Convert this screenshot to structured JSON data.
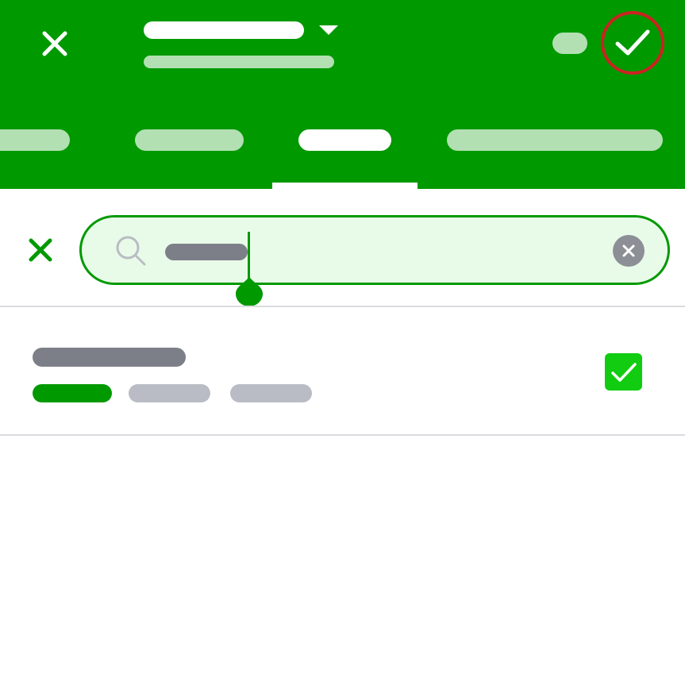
{
  "colors": {
    "primary": "#009900",
    "primary_light": "#b3e0b3",
    "search_background": "#e8fbe8",
    "confirm_highlight": "#cc2222",
    "checkbox": "#11cc11",
    "placeholder_dark": "#7d7f88",
    "placeholder_light": "#b9bcc4"
  },
  "header": {
    "close_icon": "close-icon",
    "dropdown_icon": "caret-down-icon",
    "confirm_icon": "checkmark-icon"
  },
  "tabs": {
    "count": 4,
    "active_index": 2
  },
  "search": {
    "search_icon": "magnifier-icon",
    "clear_icon": "clear-circle-icon",
    "close_icon": "close-icon"
  },
  "list": {
    "items": [
      {
        "checked": true,
        "checkbox_icon": "checkmark-icon"
      }
    ]
  }
}
